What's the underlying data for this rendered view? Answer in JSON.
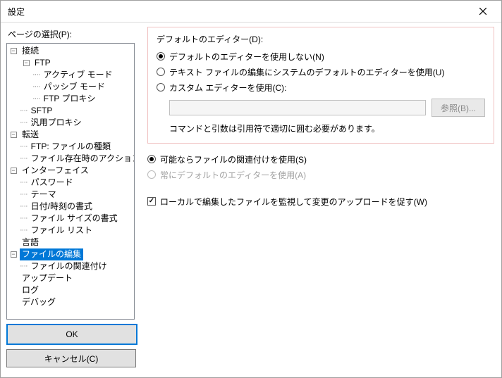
{
  "title": "設定",
  "left": {
    "label": "ページの選択(P):",
    "ok": "OK",
    "cancel": "キャンセル(C)"
  },
  "tree": {
    "connection": "接続",
    "ftp": "FTP",
    "active": "アクティブ モード",
    "passive": "パッシブ モード",
    "proxy": "FTP プロキシ",
    "sftp": "SFTP",
    "generic_proxy": "汎用プロキシ",
    "transfer": "転送",
    "ftp_filetypes": "FTP: ファイルの種類",
    "file_exists": "ファイル存在時のアクション",
    "interface": "インターフェイス",
    "password": "パスワード",
    "theme": "テーマ",
    "datetime": "日付/時刻の書式",
    "filesize": "ファイル サイズの書式",
    "filelist": "ファイル リスト",
    "language": "言語",
    "file_edit": "ファイルの編集",
    "file_assoc": "ファイルの関連付け",
    "update": "アップデート",
    "log": "ログ",
    "debug": "デバッグ"
  },
  "right": {
    "group_label": "デフォルトのエディター(D):",
    "r1": "デフォルトのエディターを使用しない(N)",
    "r2": "テキスト ファイルの編集にシステムのデフォルトのエディターを使用(U)",
    "r3": "カスタム エディターを使用(C):",
    "browse": "参照(B)...",
    "hint": "コマンドと引数は引用符で適切に囲む必要があります。",
    "r4": "可能ならファイルの関連付けを使用(S)",
    "r5": "常にデフォルトのエディターを使用(A)",
    "watch": "ローカルで編集したファイルを監視して変更のアップロードを促す(W)"
  }
}
